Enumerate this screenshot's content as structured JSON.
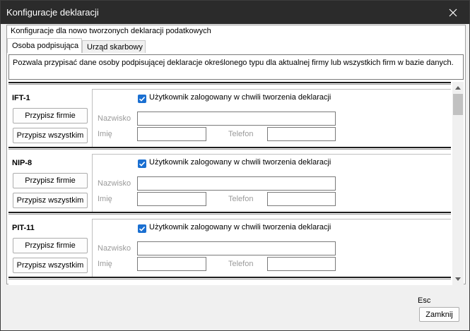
{
  "window": {
    "title": "Konfiguracje deklaracji",
    "close_icon": "close-icon"
  },
  "header": {
    "text": "Konfiguracje dla nowo tworzonych deklaracji podatkowych"
  },
  "tabs": [
    {
      "label": "Osoba podpisująca",
      "active": true
    },
    {
      "label": "Urząd skarbowy",
      "active": false
    }
  ],
  "description": "Pozwala przypisać dane osoby podpisującej deklaracje określonego typu dla aktualnej firmy lub wszystkich firm w bazie danych.",
  "labels": {
    "checkbox": "Użytkownik zalogowany w chwili tworzenia deklaracji",
    "nazwisko": "Nazwisko",
    "imie": "Imię",
    "telefon": "Telefon",
    "assign_company": "Przypisz firmie",
    "assign_all": "Przypisz wszystkim"
  },
  "declarations": [
    {
      "name": "IFT-1",
      "checked": true,
      "nazwisko": "",
      "imie": "",
      "telefon": ""
    },
    {
      "name": "NIP-8",
      "checked": true,
      "nazwisko": "",
      "imie": "",
      "telefon": ""
    },
    {
      "name": "PIT-11",
      "checked": true,
      "nazwisko": "",
      "imie": "",
      "telefon": ""
    }
  ],
  "footer": {
    "shortcut": "Esc",
    "close_label": "Zamknij"
  },
  "colors": {
    "titlebar": "#2b2b2b",
    "checkbox_accent": "#1a6fd1"
  }
}
